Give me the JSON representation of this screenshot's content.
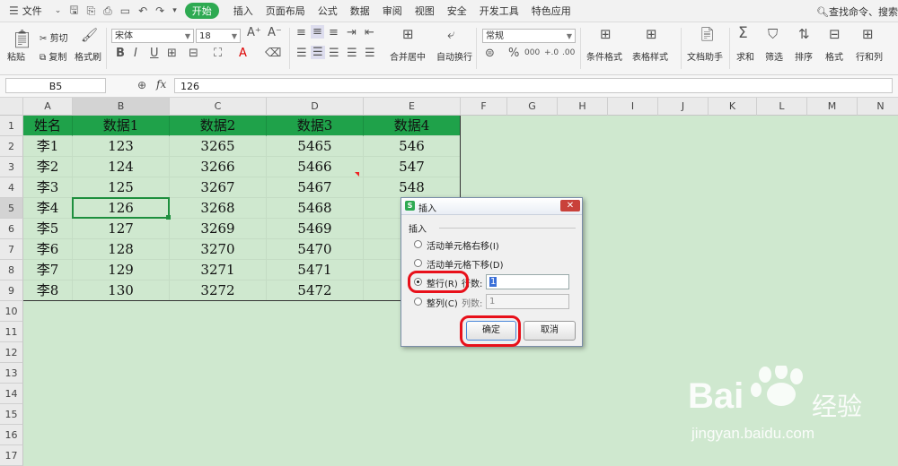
{
  "menubar": {
    "file": "文件",
    "tabs": [
      "开始",
      "插入",
      "页面布局",
      "公式",
      "数据",
      "审阅",
      "视图",
      "安全",
      "开发工具",
      "特色应用"
    ],
    "active_tab": "开始",
    "search": "查找命令、搜索"
  },
  "ribbon": {
    "paste": "粘贴",
    "cut": "剪切",
    "copy": "复制",
    "format_painter": "格式刷",
    "font_name": "宋体",
    "font_size": "18",
    "merge_center": "合并居中",
    "wrap_text": "自动换行",
    "number_format": "常规",
    "conditional_format": "条件格式",
    "table_style": "表格样式",
    "doc_helper": "文档助手",
    "sum": "求和",
    "filter": "筛选",
    "sort": "排序",
    "format": "格式",
    "row_col": "行和列"
  },
  "formula_bar": {
    "name_box": "B5",
    "fx": "fx",
    "value": "126"
  },
  "sheet": {
    "columns": [
      "A",
      "B",
      "C",
      "D",
      "E",
      "F",
      "G",
      "H",
      "I",
      "J",
      "K",
      "L",
      "M",
      "N"
    ],
    "rows": [
      "1",
      "2",
      "3",
      "4",
      "5",
      "6",
      "7",
      "8",
      "9",
      "10",
      "11",
      "12",
      "13",
      "14",
      "15",
      "16",
      "17"
    ],
    "headers": [
      "姓名",
      "数据1",
      "数据2",
      "数据3",
      "数据4"
    ],
    "data": [
      [
        "李1",
        "123",
        "3265",
        "5465",
        "546"
      ],
      [
        "李2",
        "124",
        "3266",
        "5466",
        "547"
      ],
      [
        "李3",
        "125",
        "3267",
        "5467",
        "548"
      ],
      [
        "李4",
        "126",
        "3268",
        "5468",
        "5"
      ],
      [
        "李5",
        "127",
        "3269",
        "5469",
        "5"
      ],
      [
        "李6",
        "128",
        "3270",
        "5470",
        "5"
      ],
      [
        "李7",
        "129",
        "3271",
        "5471",
        "5"
      ],
      [
        "李8",
        "130",
        "3272",
        "5472",
        "5"
      ]
    ],
    "selected_cell": "B5"
  },
  "dialog": {
    "title": "插入",
    "group": "插入",
    "opt_shift_right": "活动单元格右移(I)",
    "opt_shift_down": "活动单元格下移(D)",
    "opt_entire_row": "整行(R)",
    "rows_label": "行数:",
    "rows_value": "1",
    "opt_entire_col": "整列(C)",
    "cols_label": "列数:",
    "cols_value": "1",
    "ok": "确定",
    "cancel": "取消"
  },
  "watermark": {
    "brand": "Bai",
    "brand_cn": "经验",
    "url": "jingyan.baidu.com"
  }
}
